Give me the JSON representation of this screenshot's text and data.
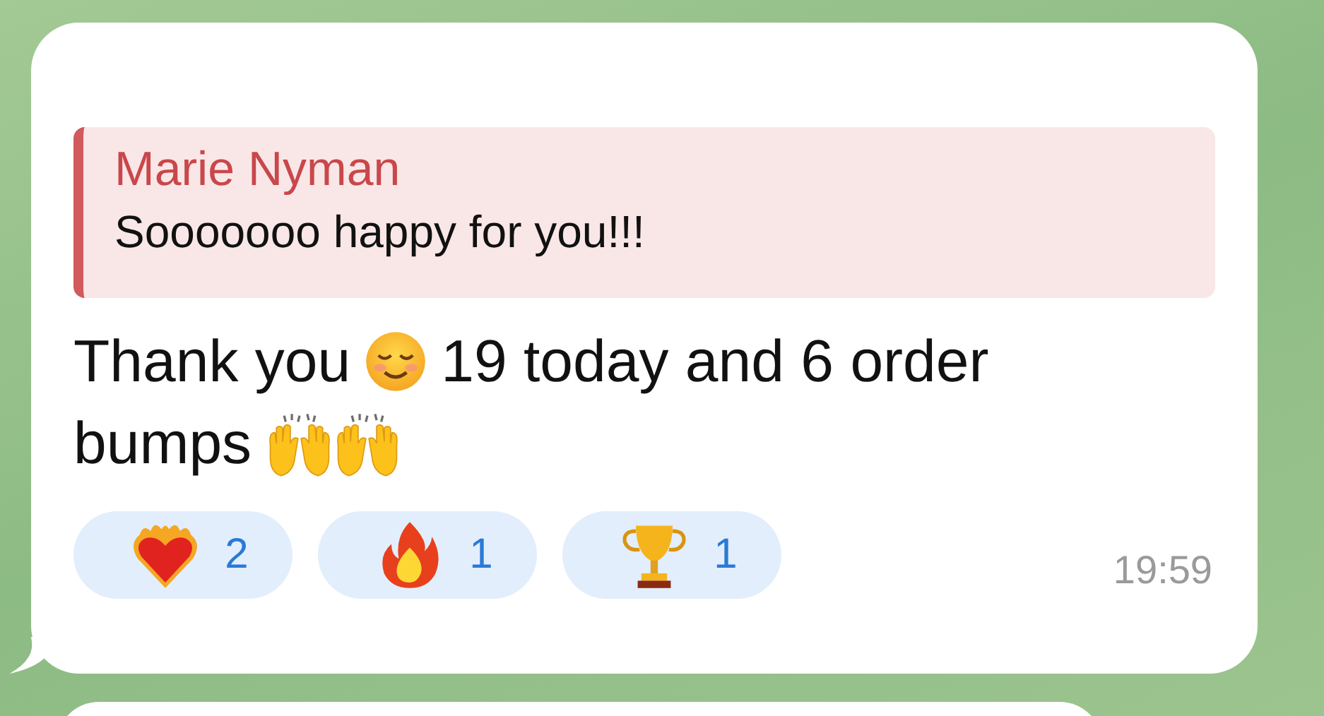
{
  "message": {
    "reply": {
      "author": "Marie Nyman",
      "text": "Sooooooo happy for you!!!"
    },
    "body": [
      {
        "kind": "text",
        "text": "Thank you"
      },
      {
        "kind": "smiling-emoji"
      },
      {
        "kind": "text",
        "text": "19 today and 6 order"
      },
      {
        "kind": "break"
      },
      {
        "kind": "text",
        "text": "bumps"
      },
      {
        "kind": "raised-hands-emoji"
      },
      {
        "kind": "raised-hands-emoji"
      }
    ],
    "reactions": [
      {
        "kind": "heart-fire",
        "count": "2"
      },
      {
        "kind": "fire",
        "count": "1"
      },
      {
        "kind": "trophy",
        "count": "1"
      }
    ],
    "time": "19:59"
  }
}
